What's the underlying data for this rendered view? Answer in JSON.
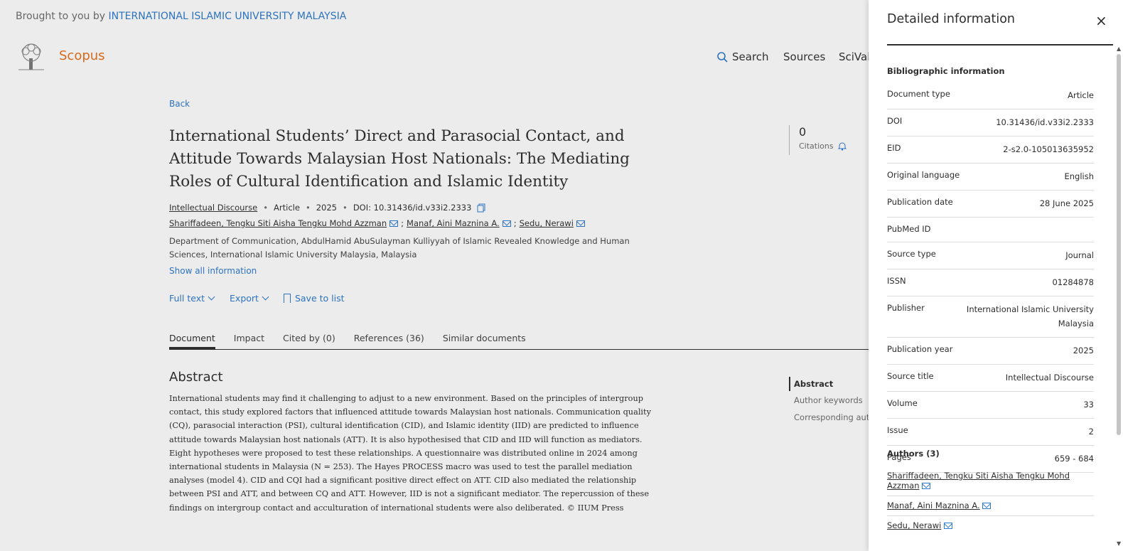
{
  "header": {
    "brought_prefix": "Brought to you by",
    "institution": "INTERNATIONAL ISLAMIC UNIVERSITY MALAYSIA",
    "brand": "Scopus",
    "nav": {
      "search": "Search",
      "sources": "Sources",
      "scival": "SciVal"
    }
  },
  "article": {
    "back": "Back",
    "title": "International Students’ Direct and Parasocial Contact, and Attitude Towards Malaysian Host Nationals: The Mediating Roles of Cultural Identification and Islamic Identity",
    "journal": "Intellectual Discourse",
    "doc_type": "Article",
    "year": "2025",
    "doi": "DOI: 10.31436/id.v33i2.2333",
    "authors": [
      "Shariffadeen, Tengku Siti Aisha Tengku Mohd Azzman",
      "Manaf, Aini Maznina A.",
      "Sedu, Nerawi"
    ],
    "separator": ";",
    "affiliation": "Department of Communication, AbdulHamid AbuSulayman Kulliyyah of Islamic Revealed Knowledge and Human Sciences, International Islamic University Malaysia, Malaysia",
    "show_all": "Show all information",
    "actions": {
      "full_text": "Full text",
      "export": "Export",
      "save": "Save to list"
    },
    "citations": {
      "count": "0",
      "label": "Citations"
    },
    "tabs": [
      "Document",
      "Impact",
      "Cited by (0)",
      "References (36)",
      "Similar documents"
    ],
    "abstract_heading": "Abstract",
    "abstract": "International students may find it challenging to adjust to a new environment. Based on the principles of intergroup contact, this study explored factors that influenced attitude towards Malaysian host nationals. Communication quality (CQ), parasocial interaction (PSI), cultural identification (CID), and Islamic identity (IID) are predicted to influence attitude towards Malaysian host nationals (ATT). It is also hypothesised that CID and IID will function as mediators. Eight hypotheses were proposed to test these relationships. A questionnaire was distributed online in 2024 among international students in Malaysia (N = 253). The Hayes PROCESS macro was used to test the parallel mediation analyses (model 4). CID and CQI had a significant positive direct effect on ATT. CID also mediated the relationship between PSI and ATT, and between CQ and ATT. However, IID is not a significant mediator. The repercussion of these findings on intergroup contact and acculturation of international students were also deliberated. © IIUM Press",
    "toc": [
      "Abstract",
      "Author keywords",
      "Corresponding authors"
    ]
  },
  "panel": {
    "title": "Detailed information",
    "close": "×",
    "biblio_heading": "Bibliographic information",
    "rows": [
      {
        "key": "Document type",
        "value": "Article"
      },
      {
        "key": "DOI",
        "value": "10.31436/id.v33i2.2333"
      },
      {
        "key": "EID",
        "value": "2-s2.0-105013635952"
      },
      {
        "key": "Original language",
        "value": "English"
      },
      {
        "key": "Publication date",
        "value": "28 June 2025"
      },
      {
        "key": "PubMed ID",
        "value": ""
      },
      {
        "key": "Source type",
        "value": "Journal"
      },
      {
        "key": "ISSN",
        "value": "01284878"
      },
      {
        "key": "Publisher",
        "value": "International Islamic University Malaysia"
      },
      {
        "key": "Publication year",
        "value": "2025"
      },
      {
        "key": "Source title",
        "value": "Intellectual Discourse"
      },
      {
        "key": "Volume",
        "value": "33"
      },
      {
        "key": "Issue",
        "value": "2"
      },
      {
        "key": "Pages",
        "value": "659 - 684"
      }
    ],
    "authors_heading": "Authors (3)",
    "authors": [
      "Shariffadeen, Tengku Siti Aisha Tengku Mohd Azzman",
      "Manaf, Aini Maznina A.",
      "Sedu, Nerawi"
    ]
  }
}
